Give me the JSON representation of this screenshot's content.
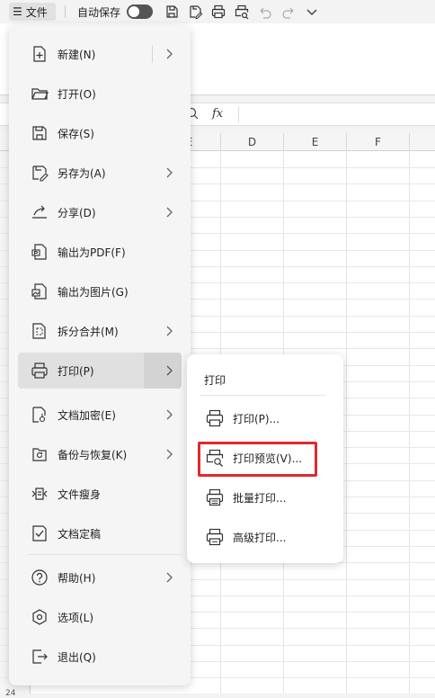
{
  "toolbar": {
    "menu_glyph": "☰",
    "file_label": "文件",
    "autosave_label": "自动保存",
    "autosave_on": false,
    "icons": [
      "save-icon",
      "save-as-icon",
      "print-icon",
      "print-preview-icon",
      "undo-icon",
      "redo-icon",
      "chevron-down-icon"
    ]
  },
  "formula_bar": {
    "fx_label": "fx"
  },
  "sheet": {
    "column_headers": [
      "E",
      "D",
      "E",
      "F"
    ],
    "row_label_bottom": "24"
  },
  "file_menu": {
    "items": [
      {
        "label": "新建(N)",
        "icon": "new-file-icon",
        "has_submenu": true,
        "split": true
      },
      {
        "label": "打开(O)",
        "icon": "open-folder-icon",
        "has_submenu": false
      },
      {
        "label": "保存(S)",
        "icon": "save-icon",
        "has_submenu": false
      },
      {
        "label": "另存为(A)",
        "icon": "save-as-icon",
        "has_submenu": true
      },
      {
        "label": "分享(D)",
        "icon": "share-icon",
        "has_submenu": true
      },
      {
        "label": "输出为PDF(F)",
        "icon": "export-pdf-icon",
        "has_submenu": false
      },
      {
        "label": "输出为图片(G)",
        "icon": "export-image-icon",
        "has_submenu": false
      },
      {
        "label": "拆分合并(M)",
        "icon": "split-merge-icon",
        "has_submenu": true
      },
      {
        "label": "打印(P)",
        "icon": "print-icon",
        "has_submenu": true,
        "active": true
      },
      {
        "label": "文档加密(E)",
        "icon": "encrypt-icon",
        "has_submenu": true
      },
      {
        "label": "备份与恢复(K)",
        "icon": "backup-icon",
        "has_submenu": true
      },
      {
        "label": "文件瘦身",
        "icon": "slim-file-icon",
        "has_submenu": false
      },
      {
        "label": "文档定稿",
        "icon": "finalize-icon",
        "has_submenu": false
      },
      {
        "label": "帮助(H)",
        "icon": "help-icon",
        "has_submenu": true
      },
      {
        "label": "选项(L)",
        "icon": "options-icon",
        "has_submenu": false
      },
      {
        "label": "退出(Q)",
        "icon": "exit-icon",
        "has_submenu": false
      }
    ]
  },
  "print_submenu": {
    "title": "打印",
    "items": [
      {
        "label": "打印(P)...",
        "icon": "print-icon"
      },
      {
        "label": "打印预览(V)...",
        "icon": "print-preview-icon",
        "highlighted": true
      },
      {
        "label": "批量打印...",
        "icon": "batch-print-icon"
      },
      {
        "label": "高级打印...",
        "icon": "advanced-print-icon"
      }
    ]
  },
  "colors": {
    "highlight": "#e0282e",
    "menu_bg": "#f5f5f5",
    "active_bg": "#e0e0e0"
  }
}
